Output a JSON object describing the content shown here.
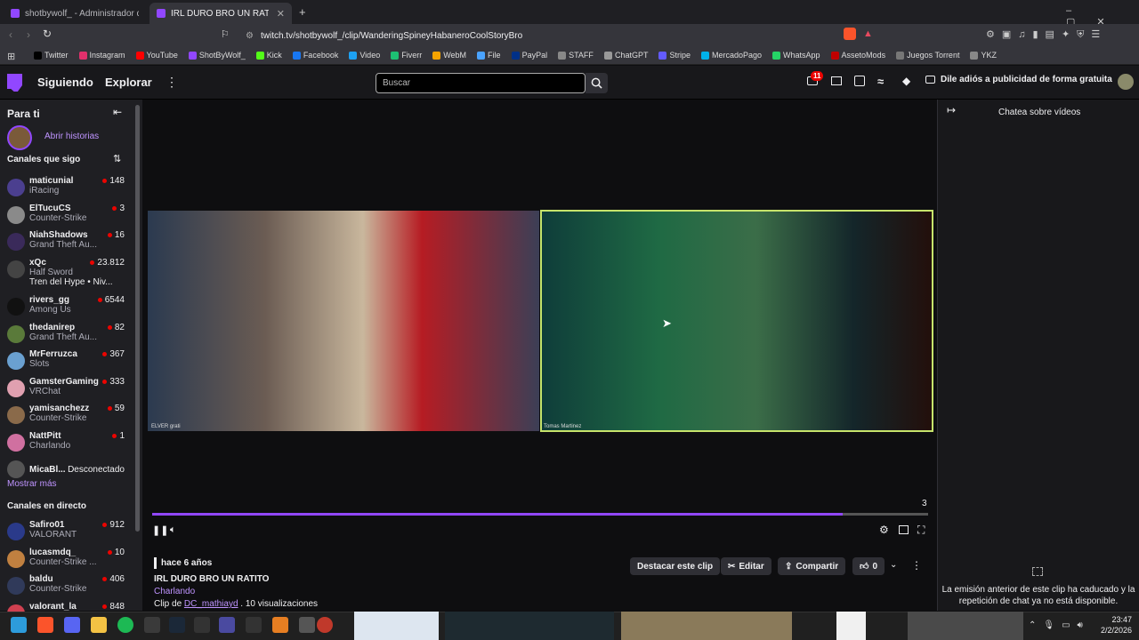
{
  "browser": {
    "tabs": [
      {
        "title": "shotbywolf_ - Administrador de clips"
      },
      {
        "title": "IRL DURO BRO UN RATITO - T"
      }
    ],
    "url": "twitch.tv/shotbywolf_/clip/WanderingSpineyHabaneroCoolStoryBro",
    "bookmarks": [
      {
        "label": "Twitter",
        "color": "#000000"
      },
      {
        "label": "Instagram",
        "color": "#e1306c"
      },
      {
        "label": "YouTube",
        "color": "#ff0000"
      },
      {
        "label": "ShotByWolf_",
        "color": "#9147ff"
      },
      {
        "label": "Kick",
        "color": "#53fc18"
      },
      {
        "label": "Facebook",
        "color": "#1877f2"
      },
      {
        "label": "Video",
        "color": "#1da1f2"
      },
      {
        "label": "Fiverr",
        "color": "#1dbf73"
      },
      {
        "label": "WebM",
        "color": "#f4a300"
      },
      {
        "label": "File",
        "color": "#4aa3ff"
      },
      {
        "label": "PayPal",
        "color": "#003087"
      },
      {
        "label": "STAFF",
        "color": "#888888"
      },
      {
        "label": "ChatGPT",
        "color": "#999999"
      },
      {
        "label": "Stripe",
        "color": "#635bff"
      },
      {
        "label": "MercadoPago",
        "color": "#00b1ea"
      },
      {
        "label": "WhatsApp",
        "color": "#25d366"
      },
      {
        "label": "AssetoMods",
        "color": "#c00000"
      },
      {
        "label": "Juegos Torrent",
        "color": "#777777"
      },
      {
        "label": "YKZ",
        "color": "#888888"
      }
    ]
  },
  "nav": {
    "following": "Siguiendo",
    "browse": "Explorar",
    "search_placeholder": "Buscar",
    "notif_count": "11",
    "adfree": "Dile adiós a publicidad de forma gratuita"
  },
  "sidebar": {
    "for_you": "Para ti",
    "stories": "Abrir historias",
    "followed_title": "Canales que sigo",
    "followed": [
      {
        "name": "maticunial",
        "game": "iRacing",
        "viewers": "148",
        "color": "#4b3f8f"
      },
      {
        "name": "ElTucuCS",
        "game": "Counter-Strike",
        "viewers": "3",
        "color": "#8a8a8a"
      },
      {
        "name": "NiahShadows",
        "game": "Grand Theft Au...",
        "viewers": "16",
        "color": "#3a2a5a"
      },
      {
        "name": "xQc",
        "game": "Half Sword",
        "viewers": "23.812",
        "color": "#444444",
        "extra": "Tren del Hype • Niv..."
      },
      {
        "name": "rivers_gg",
        "game": "Among Us",
        "viewers": "6544",
        "color": "#111111"
      },
      {
        "name": "thedanirep",
        "game": "Grand Theft Au...",
        "viewers": "82",
        "color": "#5a7a3a"
      },
      {
        "name": "MrFerruzca",
        "game": "Slots",
        "viewers": "367",
        "color": "#6aa0d0"
      },
      {
        "name": "GamsterGaming",
        "game": "VRChat",
        "viewers": "333",
        "color": "#e0a0b0"
      },
      {
        "name": "yamisanchezz",
        "game": "Counter-Strike",
        "viewers": "59",
        "color": "#8a6a4a"
      },
      {
        "name": "NattPitt",
        "game": "Charlando",
        "viewers": "1",
        "color": "#d070a0"
      },
      {
        "name": "MicaBl...",
        "game": "",
        "viewers": "Desconectado",
        "color": "#555555",
        "offline": true
      }
    ],
    "show_more": "Mostrar más",
    "live_title": "Canales en directo",
    "live": [
      {
        "name": "Safiro01",
        "game": "VALORANT",
        "viewers": "912",
        "color": "#2a3a8a"
      },
      {
        "name": "lucasmdq_",
        "game": "Counter-Strike ...",
        "viewers": "10",
        "color": "#c08040"
      },
      {
        "name": "baldu",
        "game": "Counter-Strike",
        "viewers": "406",
        "color": "#303a5a"
      },
      {
        "name": "valorant_la",
        "game": "",
        "viewers": "848",
        "color": "#d04050"
      }
    ]
  },
  "player": {
    "left_label": "ELVER grati",
    "right_label": "Tomas Martinez",
    "time_remaining": "3",
    "progress": 0.89
  },
  "clip": {
    "age": "hace 6 años",
    "title": "IRL DURO BRO UN RATITO",
    "category": "Charlando",
    "clip_by_prefix": "Clip de",
    "clipper": "DC_mathiayd",
    "views": ". 10 visualizaciones",
    "feature_label": "Destacar este clip",
    "edit_label": "Editar",
    "share_label": "Compartir",
    "likes": "0"
  },
  "chat": {
    "header": "Chatea sobre vídeos",
    "unavailable": "La emisión anterior de este clip ha caducado y la repetición de chat ya no está disponible."
  },
  "taskbar": {
    "time": "23:47",
    "date": "2/2/2026"
  }
}
